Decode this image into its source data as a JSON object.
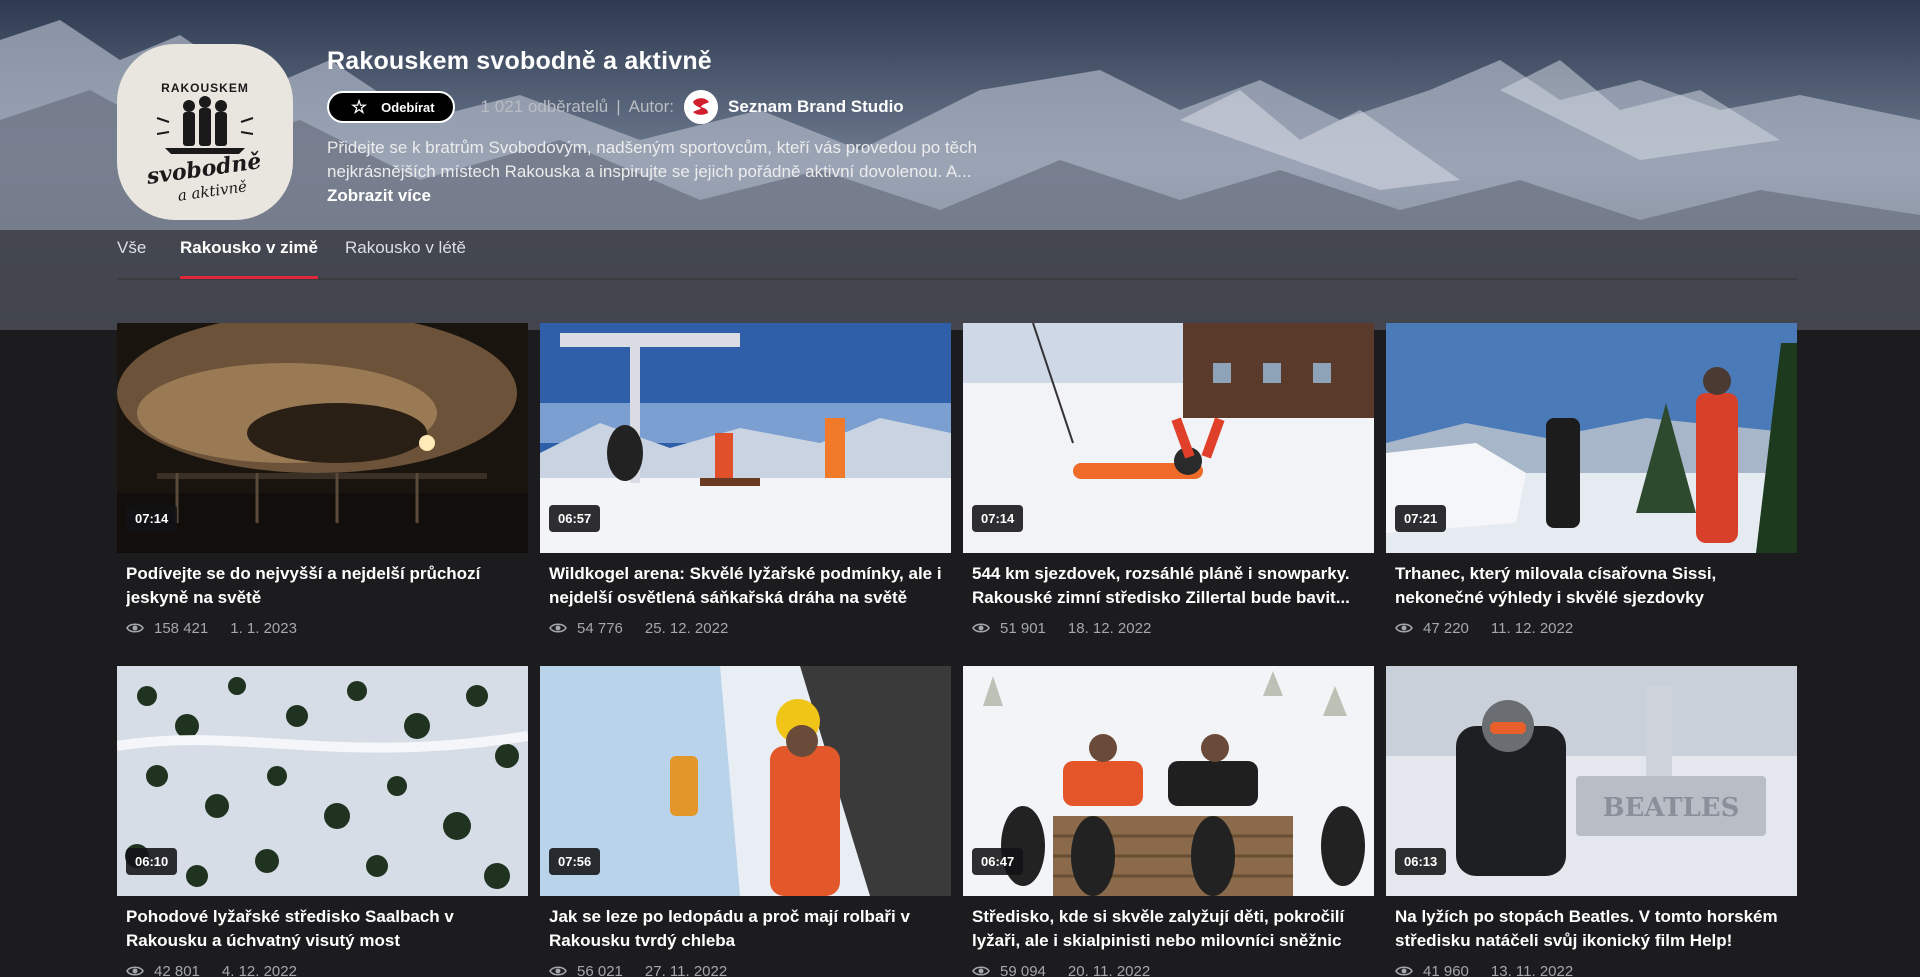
{
  "channel": {
    "title": "Rakouskem svobodně a aktivně",
    "subscribe_label": "Odebírat",
    "subscribers": "1 021 odběratelů",
    "separator": "|",
    "author_label": "Autor:",
    "author_name": "Seznam Brand Studio",
    "description": "Přidejte se k bratrům Svobodovým, nadšeným sportovcům, kteří vás provedou po těch nejkrásnějších místech Rakouska a inspirujte se jejich pořádně aktivní dovolenou. A...",
    "show_more": "Zobrazit více",
    "logo_text_top": "RAKOUSKEM",
    "logo_text_main": "svobodně",
    "logo_text_sub": "a aktivně"
  },
  "tabs": [
    {
      "label": "Vše"
    },
    {
      "label": "Rakousko v zimě",
      "active": true
    },
    {
      "label": "Rakousko v létě"
    }
  ],
  "videos": [
    {
      "duration": "07:14",
      "title": "Podívejte se do nejvyšší a nejdelší průchozí jeskyně na světě",
      "views": "158 421",
      "date": "1. 1. 2023"
    },
    {
      "duration": "06:57",
      "title": "Wildkogel arena: Skvělé lyžařské podmínky, ale i nejdelší osvětlená sáňkařská dráha na světě",
      "views": "54 776",
      "date": "25. 12. 2022"
    },
    {
      "duration": "07:14",
      "title": "544 km sjezdovek, rozsáhlé pláně i snowparky. Rakouské zimní středisko Zillertal bude bavit...",
      "views": "51 901",
      "date": "18. 12. 2022"
    },
    {
      "duration": "07:21",
      "title": "Trhanec, který milovala císařovna Sissi, nekonečné výhledy i skvělé sjezdovky",
      "views": "47 220",
      "date": "11. 12. 2022"
    },
    {
      "duration": "06:10",
      "title": "Pohodové lyžařské středisko Saalbach v Rakousku a úchvatný visutý most",
      "views": "42 801",
      "date": "4. 12. 2022"
    },
    {
      "duration": "07:56",
      "title": "Jak se leze po ledopádu a proč mají rolbaři v Rakousku tvrdý chleba",
      "views": "56 021",
      "date": "27. 11. 2022"
    },
    {
      "duration": "06:47",
      "title": "Středisko, kde si skvěle zalyžují děti, pokročilí lyžaři, ale i skialpinisti nebo milovníci sněžnic",
      "views": "59 094",
      "date": "20. 11. 2022"
    },
    {
      "duration": "06:13",
      "title": "Na lyžích po stopách Beatles. V tomto horském středisku natáčeli svůj ikonický film Help!",
      "views": "41 960",
      "date": "13. 11. 2022"
    }
  ],
  "colors": {
    "accent": "#e0263a",
    "background": "#1c1c1e",
    "muted_text": "#a4a7ad"
  },
  "icons": {
    "subscribe": "star-outline-icon",
    "views": "eye-icon"
  }
}
